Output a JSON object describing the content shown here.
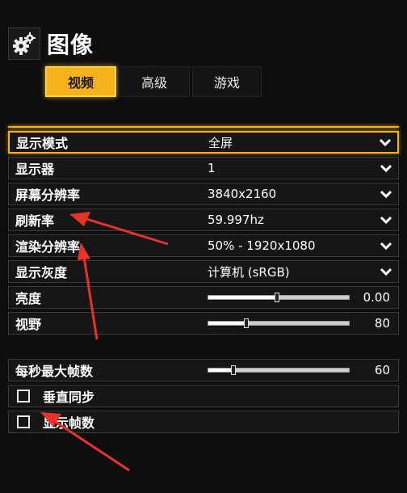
{
  "header": {
    "title": "图像",
    "icon": "gear-icon"
  },
  "tabs": [
    {
      "label": "视频",
      "active": true
    },
    {
      "label": "高级",
      "active": false
    },
    {
      "label": "游戏",
      "active": false
    }
  ],
  "settings": [
    {
      "label": "显示模式",
      "value": "全屏",
      "type": "dropdown"
    },
    {
      "label": "显示器",
      "value": "1",
      "type": "dropdown"
    },
    {
      "label": "屏幕分辨率",
      "value": "3840x2160",
      "type": "dropdown"
    },
    {
      "label": "刷新率",
      "value": "59.997hz",
      "type": "dropdown"
    },
    {
      "label": "渲染分辨率",
      "value": "50% - 1920x1080",
      "type": "dropdown"
    },
    {
      "label": "显示灰度",
      "value": "计算机 (sRGB)",
      "type": "dropdown"
    },
    {
      "label": "亮度",
      "value": "0.00",
      "type": "slider",
      "fraction": 0.49
    },
    {
      "label": "视野",
      "value": "80",
      "type": "slider",
      "fraction": 0.27
    }
  ],
  "fps": {
    "label": "每秒最大帧数",
    "value": "60",
    "fraction": 0.18
  },
  "checkboxes": [
    {
      "label": "垂直同步",
      "checked": false
    },
    {
      "label": "显示帧数",
      "checked": false
    }
  ],
  "colors": {
    "accent": "#f5b21a",
    "annotation": "#e8322a",
    "background": "#0e0e0e"
  }
}
